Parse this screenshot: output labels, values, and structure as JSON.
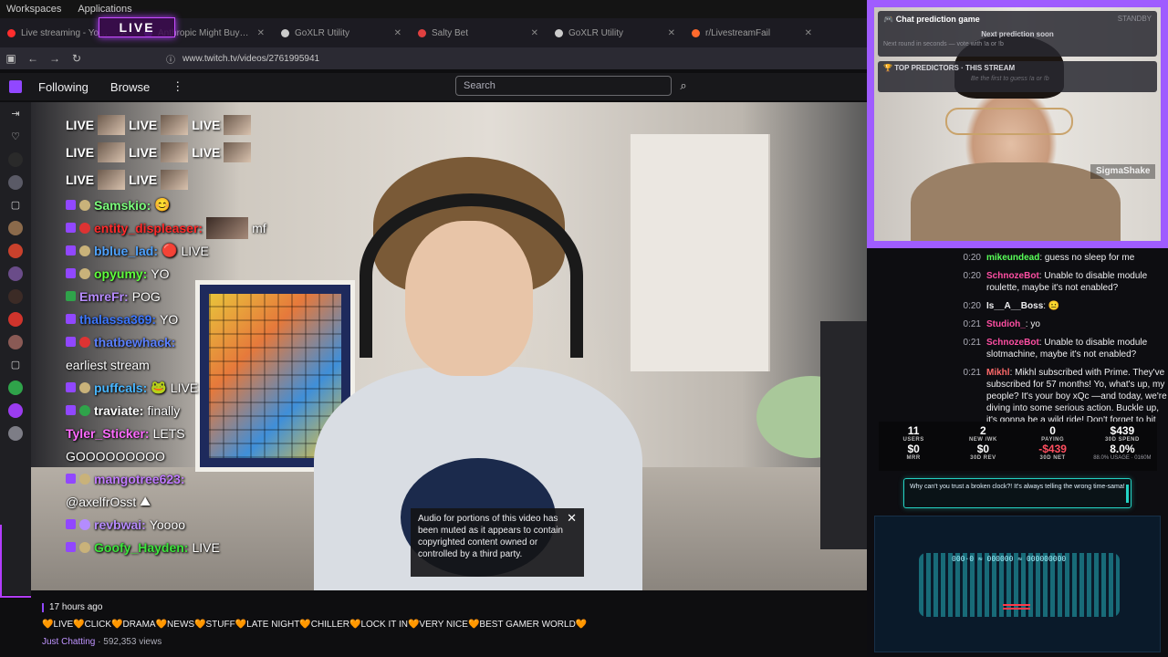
{
  "desktop": {
    "menu": [
      "Workspaces",
      "Applications"
    ]
  },
  "live_badge": "LIVE",
  "tabs": [
    {
      "title": "Live streaming - YouTube",
      "color": "#ff2d2d"
    },
    {
      "title": "Anthropic Might Buy AI",
      "color": "#9147ff"
    },
    {
      "title": "GoXLR Utility",
      "color": "#cccccc"
    },
    {
      "title": "Salty Bet",
      "color": "#e04040"
    },
    {
      "title": "GoXLR Utility",
      "color": "#cccccc"
    },
    {
      "title": "r/LivestreamFail",
      "color": "#ff6a2d"
    }
  ],
  "browser": {
    "url": "www.twitch.tv/videos/2761995941"
  },
  "twitch_nav": {
    "following": "Following",
    "browse": "Browse",
    "more": "⋮",
    "search_placeholder": "Search"
  },
  "video_overlay_chat": {
    "emote_text": "LIVE",
    "messages": [
      {
        "user": "Samskio:",
        "text": "",
        "color": "#7cff7c"
      },
      {
        "user": "entity_displeaser:",
        "text": "mf",
        "color": "#ff2b2b"
      },
      {
        "user": "bblue_lad:",
        "text": "LIVE",
        "color": "#4fa2ff"
      },
      {
        "user": "opyumy:",
        "text": "YO",
        "color": "#5fff3c"
      },
      {
        "user": "EmreFr:",
        "text": "POG",
        "color": "#b78cff"
      },
      {
        "user": "thalassa369:",
        "text": "YO",
        "color": "#3d77ff"
      },
      {
        "user": "thatbewhack:",
        "text": "",
        "color": "#5b80ff"
      },
      {
        "user": "",
        "text": "earliest stream",
        "color": "#ffffff"
      },
      {
        "user": "puffcals:",
        "text": "LIVE",
        "color": "#49b6ff"
      },
      {
        "user": "traviate:",
        "text": "finally",
        "color": "#ffffff"
      },
      {
        "user": "Tyler_Sticker:",
        "text": "LETS",
        "color": "#ff6bff"
      },
      {
        "user": "",
        "text": "GOOOOOOOOO",
        "color": "#ffffff"
      },
      {
        "user": "mangotree623:",
        "text": "",
        "color": "#c17bff"
      },
      {
        "user": "",
        "text": "@axelfrOsst",
        "color": "#ffffff"
      },
      {
        "user": "revbwai:",
        "text": "Yoooo",
        "color": "#b78cff"
      },
      {
        "user": "Goofy_Hayden:",
        "text": "LIVE",
        "color": "#3de43d"
      }
    ]
  },
  "muted_notice": "Audio for portions of this video has been muted as it appears to contain copyrighted content owned or controlled by a third party.",
  "video_meta": {
    "time_ago": "17 hours ago",
    "title": "🧡LIVE🧡CLICK🧡DRAMA🧡NEWS🧡STUFF🧡LATE NIGHT🧡CHILLER🧡LOCK IT IN🧡VERY NICE🧡BEST GAMER WORLD🧡",
    "category": "Just Chatting",
    "views": "592,353 views"
  },
  "prediction": {
    "title": "Chat prediction game",
    "status": "STANDBY",
    "line1": "Next prediction soon",
    "line2": "Next round in seconds — vote with !a or !b",
    "top_title": "TOP PREDICTORS · THIS STREAM",
    "top_sub": "Be the first to guess !a or !b"
  },
  "cam_label": "SigmaShake",
  "right_chat": [
    {
      "time": "0:20",
      "user": "mikeundead",
      "text": "guess no sleep for me",
      "color": "#59ff59"
    },
    {
      "time": "0:20",
      "user": "SchnozeBot",
      "text": "Unable to disable module roulette, maybe it's not enabled?",
      "color": "#ff4fa3"
    },
    {
      "time": "0:20",
      "user": "Is__A__Boss",
      "text": "",
      "color": "#e6e6e6"
    },
    {
      "time": "0:21",
      "user": "Studioh_",
      "text": "yo",
      "color": "#ff4fa3"
    },
    {
      "time": "0:21",
      "user": "SchnozeBot",
      "text": "Unable to disable module slotmachine, maybe it's not enabled?",
      "color": "#ff4fa3"
    },
    {
      "time": "0:21",
      "user": "Mikhl",
      "text": "Mikhl subscribed with Prime. They've subscribed for 57 months! Yo, what's up, my people? It's your boy xQc —and today, we're diving into some serious action. Buckle up, it's gonna be a wild ride! Don't forget to hit the like button if you're ready to cop!",
      "color": "#ff6a6a"
    }
  ],
  "stats": [
    {
      "value": "11",
      "label": "USERS",
      "value2": "$0",
      "label2": "MRR"
    },
    {
      "value": "2",
      "label": "NEW /WK",
      "value2": "$0",
      "label2": "30D REV"
    },
    {
      "value": "0",
      "label": "PAYING",
      "value2": "-$439",
      "label2": "30D NET"
    },
    {
      "value": "$439",
      "label": "30D SPEND",
      "value2": "8.0%",
      "label2": "88.0% USAGE · 0160M"
    }
  ],
  "joke": "Why can't you trust a broken clock?! It's always telling the wrong time-sama!",
  "keyboard_text": "000·0 ≈ 000000 ≈ 000000000"
}
